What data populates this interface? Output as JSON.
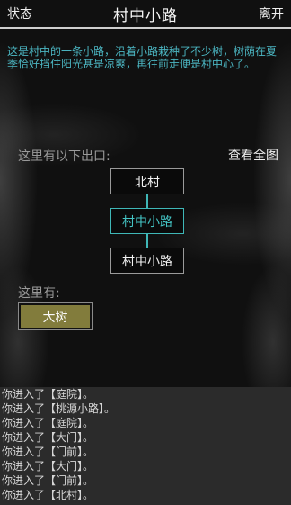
{
  "topbar": {
    "status_label": "状态",
    "title": "村中小路",
    "leave_label": "离开"
  },
  "description": "这是村中的一条小路，沿着小路栽种了不少树，树荫在夏季恰好挡住阳光甚是凉爽，再往前走便是村中心了。",
  "exits": {
    "label": "这里有以下出口:",
    "full_map_label": "查看全图",
    "north": "北村",
    "current": "村中小路",
    "south": "村中小路"
  },
  "here": {
    "label": "这里有:",
    "objects": [
      "大树"
    ]
  },
  "log": [
    "你进入了【庭院】。",
    "你进入了【桃源小路】。",
    "你进入了【庭院】。",
    "你进入了【大门】。",
    "你进入了【门前】。",
    "你进入了【大门】。",
    "你进入了【门前】。",
    "你进入了【北村】。"
  ],
  "colors": {
    "accent": "#3fb7b7",
    "description_text": "#4bb5c1",
    "object_button": "#827c3c",
    "log_background": "#2b2b2b"
  }
}
